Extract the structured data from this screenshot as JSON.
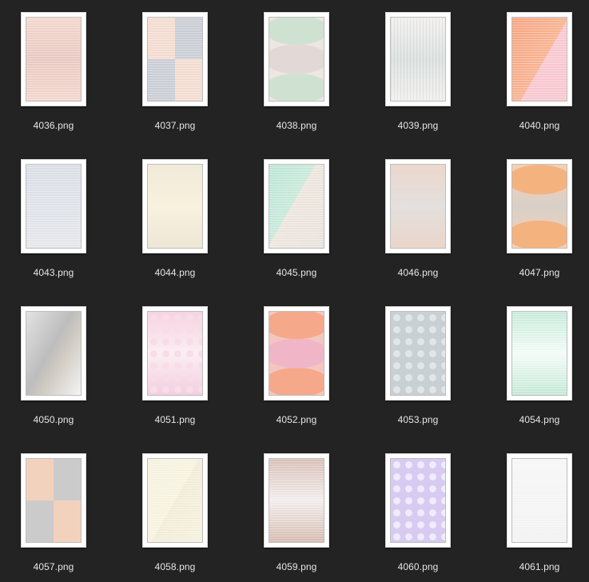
{
  "files": [
    {
      "name": "4036.png",
      "art": "linear-gradient(180deg,#f2d6cc 0%,#e9c7c0 50%,#f2d6cc 100%)",
      "overlay": "stripes-h"
    },
    {
      "name": "4037.png",
      "art": "conic-gradient(from 90deg at 50% 50%,#f3dbd0 0 25%,#c9ccd4 0 50%,#f3dbd0 0 75%,#c9ccd4 0)",
      "overlay": "stripes-h"
    },
    {
      "name": "4038.png",
      "art": "radial-gradient(ellipse 60% 18% at 50% 15%,#cfe2d2 98%,transparent 100%),radial-gradient(ellipse 60% 18% at 50% 50%,#e2d8d6 98%,transparent 100%),radial-gradient(ellipse 60% 18% at 50% 85%,#cfe2d2 98%,transparent 100%),#ece7e4",
      "overlay": ""
    },
    {
      "name": "4039.png",
      "art": "linear-gradient(180deg,#f4f1f1 0%,#dfe5e3 50%,#f4f1f1 100%)",
      "overlay": "stripes-v"
    },
    {
      "name": "4040.png",
      "art": "linear-gradient(120deg,#f6a37e 0%,#f7b290 55%,#f8c6cf 55%,#f8c6cf 100%)",
      "overlay": "stripes-h"
    },
    {
      "name": "4043.png",
      "art": "linear-gradient(180deg,#d9dde6 0%,#e4e6ea 100%)",
      "overlay": "stripes-h"
    },
    {
      "name": "4044.png",
      "art": "linear-gradient(180deg,#f2ead8 0%,#f7f1de 50%,#efe7d6 100%)",
      "overlay": ""
    },
    {
      "name": "4045.png",
      "art": "linear-gradient(120deg,#b9e6d4 0%,#c8e8da 45%,#ede5dc 45%,#e8e2dc 100%)",
      "overlay": "stripes-h"
    },
    {
      "name": "4046.png",
      "art": "linear-gradient(180deg,#ecd7cc 0%,#e3e0de 50%,#ebd5c9 100%)",
      "overlay": ""
    },
    {
      "name": "4047.png",
      "art": "radial-gradient(ellipse 60% 18% at 50% 18%,#f4b27f 98%,transparent 100%),radial-gradient(ellipse 60% 18% at 50% 85%,#f4b27f 98%,transparent 100%),linear-gradient(180deg,#f6d0b3,#d8d0c8,#f6d0b3)",
      "overlay": ""
    },
    {
      "name": "4050.png",
      "art": "linear-gradient(120deg,#e2e2e2 0%,#bdbdbd 45%,#cfcac1 60%,#f4f4f4 100%)",
      "overlay": ""
    },
    {
      "name": "4051.png",
      "art": "radial-gradient(circle,#f8dce8 40%,transparent 42%),linear-gradient(180deg,#f6d3e0 0%,#fbeef2 50%,#f3cfe0 100%)",
      "overlay": "dots"
    },
    {
      "name": "4052.png",
      "art": "radial-gradient(ellipse 60% 18% at 50% 15%,#f5a98a 98%,transparent 100%),radial-gradient(ellipse 60% 18% at 50% 50%,#f0b6c7 98%,transparent 100%),radial-gradient(ellipse 60% 18% at 50% 85%,#f5a98a 98%,transparent 100%),#f3c7bf",
      "overlay": ""
    },
    {
      "name": "4053.png",
      "art": "radial-gradient(circle,#e1e6e8 40%,transparent 42%),#c9d0d4",
      "overlay": "dots"
    },
    {
      "name": "4054.png",
      "art": "linear-gradient(180deg,#c6ead9 0%,#f2fbf7 50%,#c3e8d6 100%)",
      "overlay": "stripes-h"
    },
    {
      "name": "4057.png",
      "art": "conic-gradient(from 90deg at 50% 50%,#f3d2bd 0 25%,#cbcbcb 0 50%,#f3d2bd 0 75%,#cbcbcb 0)",
      "overlay": ""
    },
    {
      "name": "4058.png",
      "art": "linear-gradient(120deg,#f5f1df 0%,#f7f2df 50%,#f1ecd6 50%,#f5f0dd 100%)",
      "overlay": "stripes-h"
    },
    {
      "name": "4059.png",
      "art": "linear-gradient(180deg,#d7bdb4 0%,#f2ecec 50%,#d4b9ae 100%)",
      "overlay": "stripes-h"
    },
    {
      "name": "4060.png",
      "art": "radial-gradient(circle,#f1ecfb 40%,transparent 42%),#d8cbf2",
      "overlay": "dots"
    },
    {
      "name": "4061.png",
      "art": "linear-gradient(180deg,#f6f6f6 0%,#f2f2f2 100%)",
      "overlay": "stripes-h"
    }
  ]
}
